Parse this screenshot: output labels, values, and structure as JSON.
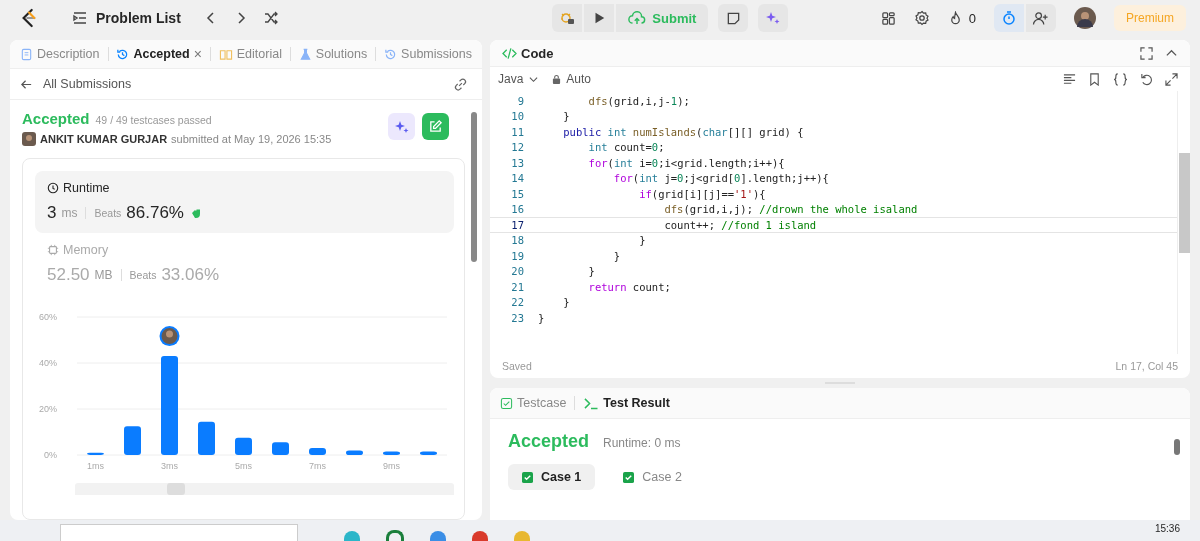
{
  "topbar": {
    "title": "Problem List",
    "submit": "Submit",
    "streak": "0",
    "premium": "Premium",
    "timer_active": true
  },
  "left_tabs": [
    {
      "label": "Description",
      "kind": "description",
      "selected": false
    },
    {
      "label": "Accepted",
      "kind": "result",
      "selected": true,
      "close": "×"
    },
    {
      "label": "Editorial",
      "kind": "editorial",
      "selected": false
    },
    {
      "label": "Solutions",
      "kind": "solutions",
      "selected": false
    },
    {
      "label": "Submissions",
      "kind": "submissions",
      "selected": false
    }
  ],
  "submission": {
    "back": "All Submissions",
    "status": "Accepted",
    "testcases": "49 / 49 testcases passed",
    "author": "ANKIT KUMAR GURJAR",
    "submitted": "submitted at May 19, 2026 15:35"
  },
  "metrics": [
    {
      "kind": "runtime",
      "label": "Runtime",
      "value": "3",
      "unit": "ms",
      "beats_label": "Beats",
      "beats": "86.76%",
      "selected": true
    },
    {
      "kind": "memory",
      "label": "Memory",
      "value": "52.50",
      "unit": "MB",
      "beats_label": "Beats",
      "beats": "33.06%",
      "selected": false
    }
  ],
  "chart_data": {
    "type": "bar",
    "x": [
      1,
      2,
      3,
      4,
      5,
      6,
      7,
      8,
      9,
      10
    ],
    "series": [
      {
        "color": "#0a7cff",
        "values": [
          1,
          12.5,
          43,
          14.5,
          7.5,
          5.5,
          3,
          2,
          1.5,
          1.5
        ]
      }
    ],
    "xlim": [
      0.5,
      10.5
    ],
    "ylim": [
      0,
      60
    ],
    "yticks": [
      {
        "value": 0,
        "label": "0%"
      },
      {
        "value": 20,
        "label": "20%"
      },
      {
        "value": 40,
        "label": "40%"
      },
      {
        "value": 60,
        "label": "60%"
      }
    ],
    "xticks": [
      {
        "value": 1,
        "label": "1ms"
      },
      {
        "value": 3,
        "label": "3ms"
      },
      {
        "value": 5,
        "label": "5ms"
      },
      {
        "value": 7,
        "label": "7ms"
      },
      {
        "value": 9,
        "label": "9ms"
      }
    ]
  },
  "editor": {
    "title": "Code",
    "language": "Java",
    "mode": "Auto",
    "status": "Saved",
    "cursor": "Ln 17, Col 45",
    "lines": [
      {
        "number": "9",
        "selected": false,
        "text": "        dfs(grid,i,j-1);"
      },
      {
        "number": "10",
        "selected": false,
        "text": "    }"
      },
      {
        "number": "11",
        "selected": false,
        "text": "    public int numIslands(char[][] grid) {"
      },
      {
        "number": "12",
        "selected": false,
        "text": "        int count=0;"
      },
      {
        "number": "13",
        "selected": false,
        "text": "        for(int i=0;i<grid.length;i++){"
      },
      {
        "number": "14",
        "selected": false,
        "text": "            for(int j=0;j<grid[0].length;j++){"
      },
      {
        "number": "15",
        "selected": false,
        "text": "                if(grid[i][j]=='1'){"
      },
      {
        "number": "16",
        "selected": false,
        "text": "                    dfs(grid,i,j); //drown the whole isaland"
      },
      {
        "number": "17",
        "selected": true,
        "text": "                    count++; //fond 1 island"
      },
      {
        "number": "18",
        "selected": false,
        "text": "                }"
      },
      {
        "number": "19",
        "selected": false,
        "text": "            }"
      },
      {
        "number": "20",
        "selected": false,
        "text": "        }"
      },
      {
        "number": "21",
        "selected": false,
        "text": "        return count;"
      },
      {
        "number": "22",
        "selected": false,
        "text": "    }"
      },
      {
        "number": "23",
        "selected": false,
        "text": "}"
      }
    ]
  },
  "test_tabs": [
    {
      "label": "Testcase",
      "kind": "testcase",
      "selected": false
    },
    {
      "label": "Test Result",
      "kind": "result",
      "selected": true
    }
  ],
  "test_result": {
    "status": "Accepted",
    "runtime": "Runtime: 0 ms",
    "cases": [
      {
        "label": "Case 1",
        "passed": true,
        "selected": true
      },
      {
        "label": "Case 2",
        "passed": true,
        "selected": false
      }
    ]
  },
  "taskbar": {
    "clock": "15:36"
  }
}
